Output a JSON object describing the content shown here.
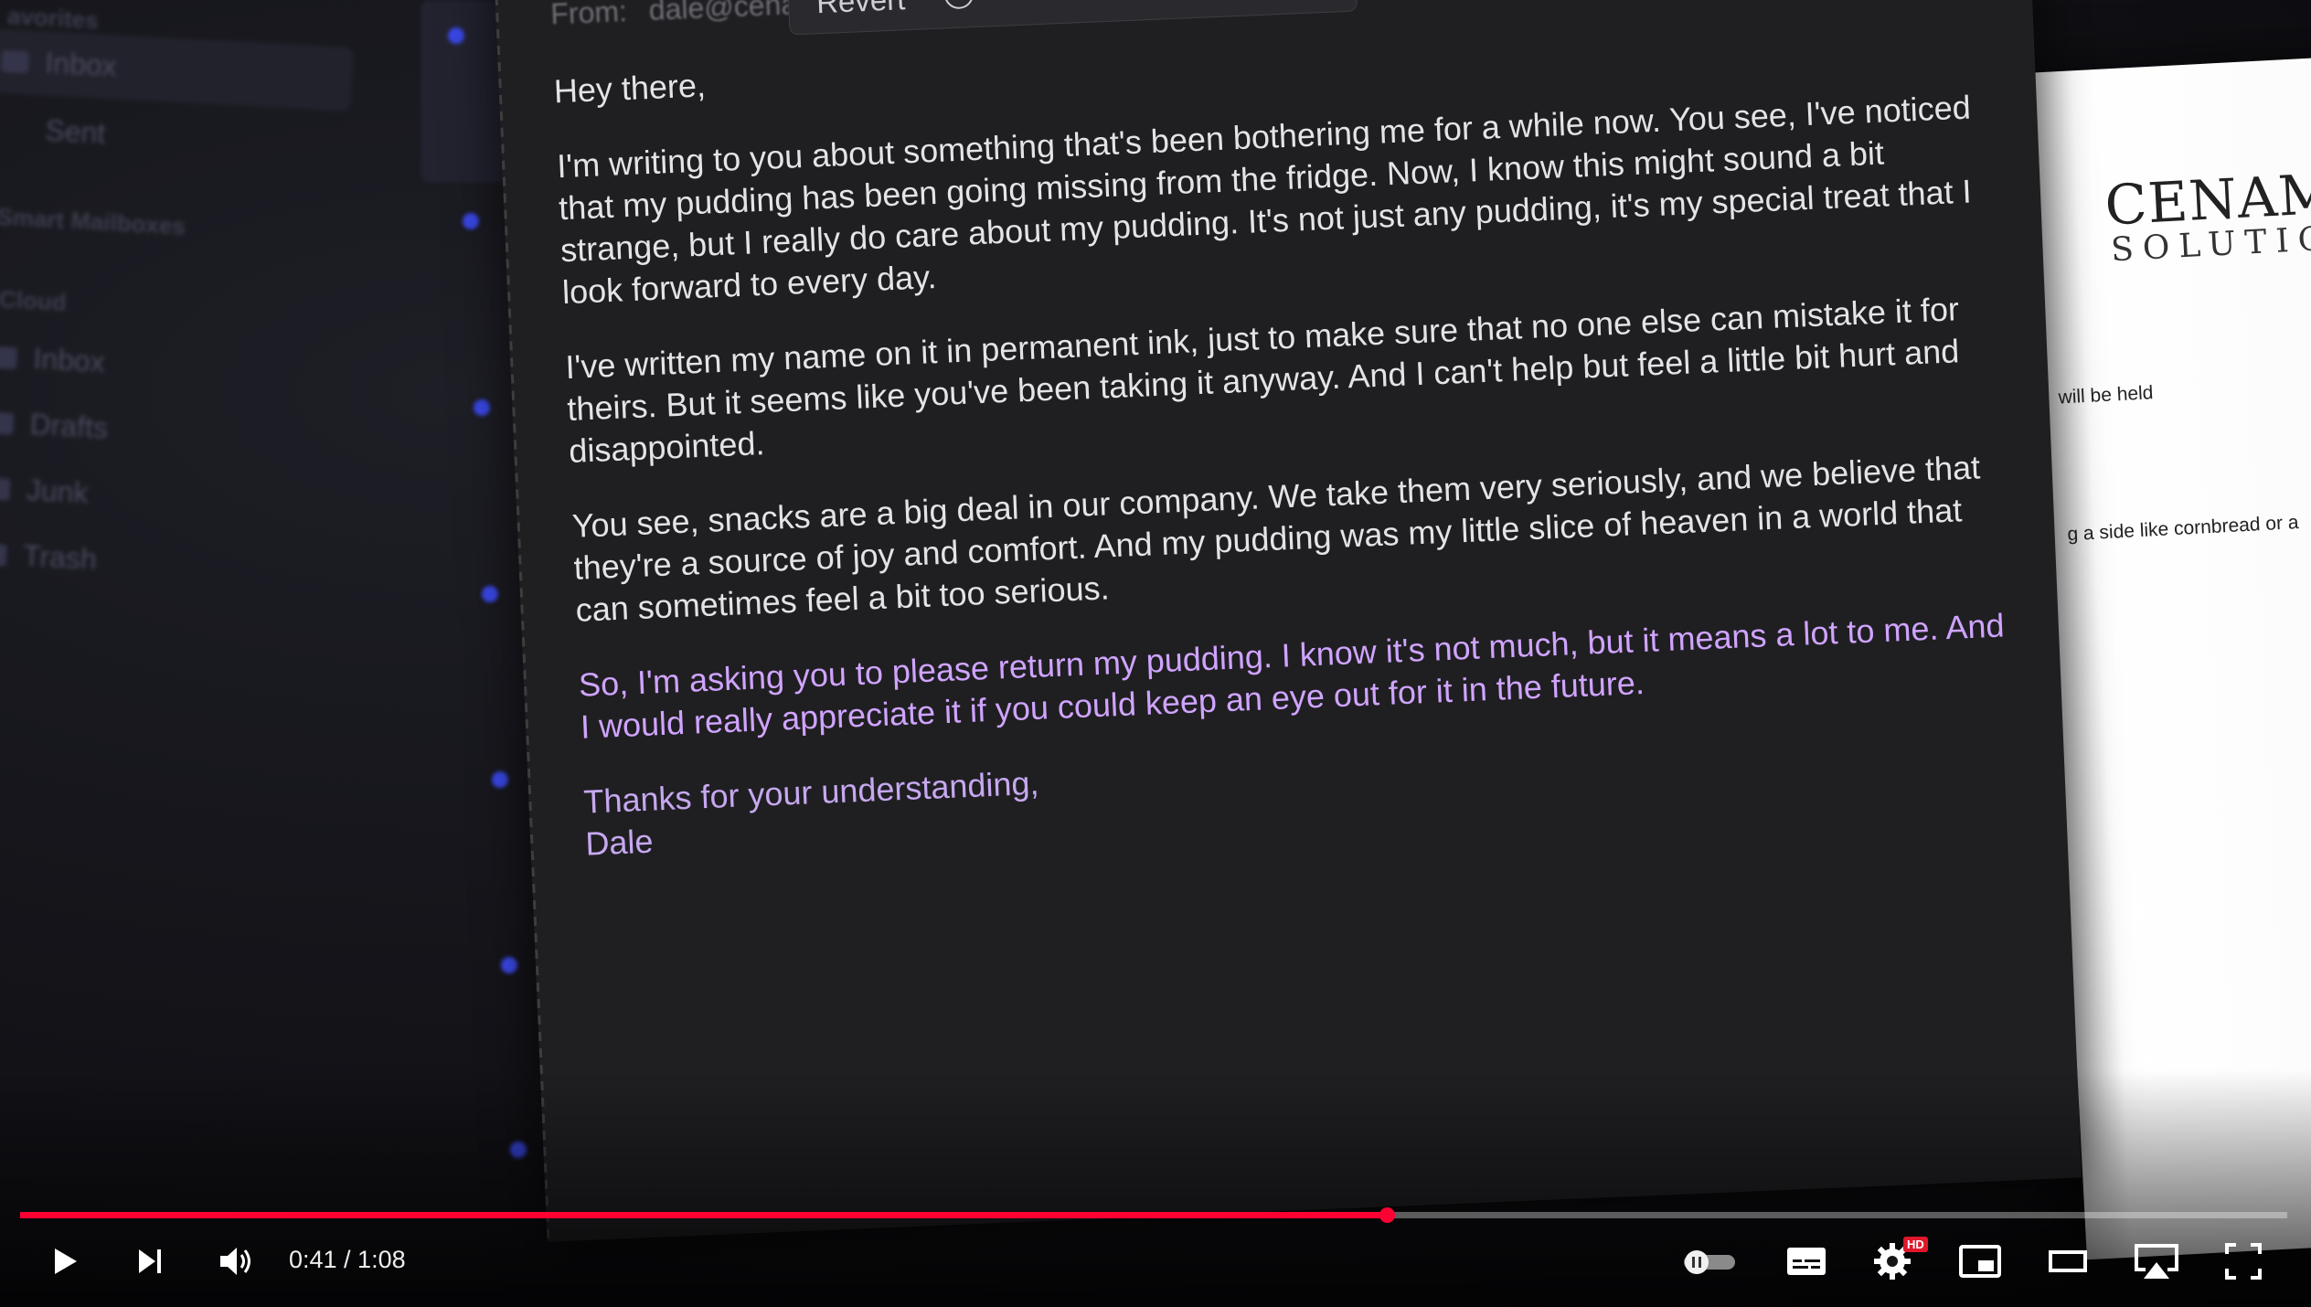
{
  "mail": {
    "sidebar": {
      "favorites_header": "avorites",
      "favorites": [
        {
          "label": "Inbox",
          "icon": "tray-icon"
        },
        {
          "label": "Sent",
          "icon": "paperplane-icon"
        }
      ],
      "smart_header": "Smart Mailboxes",
      "icloud_header": "iCloud",
      "icloud": [
        {
          "label": "Inbox",
          "icon": "tray-icon"
        },
        {
          "label": "Drafts",
          "icon": "document-icon"
        },
        {
          "label": "Junk",
          "icon": "junk-icon"
        },
        {
          "label": "Trash",
          "icon": "trash-icon"
        }
      ]
    },
    "compose": {
      "from_label": "From:",
      "from_value": "dale@cena",
      "writing_tools": {
        "revert_label": "Revert",
        "summary_icon": "summary-icon"
      },
      "body": {
        "greeting": "Hey there,",
        "p1": "I'm writing to you about something that's been bothering me for a while now. You see, I've noticed that my pudding has been going missing from the fridge. Now, I know this might sound a bit strange, but I really do care about my pudding. It's not just any pudding, it's my special treat that I look forward to every day.",
        "p2": "I've written my name on it in permanent ink, just to make sure that no one else can mistake it for theirs. But it seems like you've been taking it anyway. And I can't help but feel a little bit hurt and disappointed.",
        "p3": "You see, snacks are a big deal in our company. We take them very seriously, and we believe that they're a source of joy and comfort. And my pudding was my little slice of heaven in a world that can sometimes feel a bit too serious.",
        "p4": "So, I'm asking you to please return my pudding. I know it's not much, but it means a lot to me. And I would really appreciate it if you could keep an eye out for it in the future.",
        "closing": "Thanks for your understanding,",
        "signature": "Dale"
      }
    }
  },
  "document": {
    "title": "CENAMO",
    "subtitle": "SOLUTIO",
    "line1": "will be held",
    "line2": "g a side like cornbread or a"
  },
  "player": {
    "time_display": "0:41 / 1:08",
    "played_fraction": 0.603,
    "hd_badge": "HD",
    "accent_color": "#ff0033",
    "buttons": [
      "play-icon",
      "next-icon",
      "volume-icon",
      "autoplay-toggle-icon",
      "subtitles-icon",
      "settings-icon",
      "miniplayer-icon",
      "theater-mode-icon",
      "airplay-icon",
      "fullscreen-icon"
    ]
  }
}
